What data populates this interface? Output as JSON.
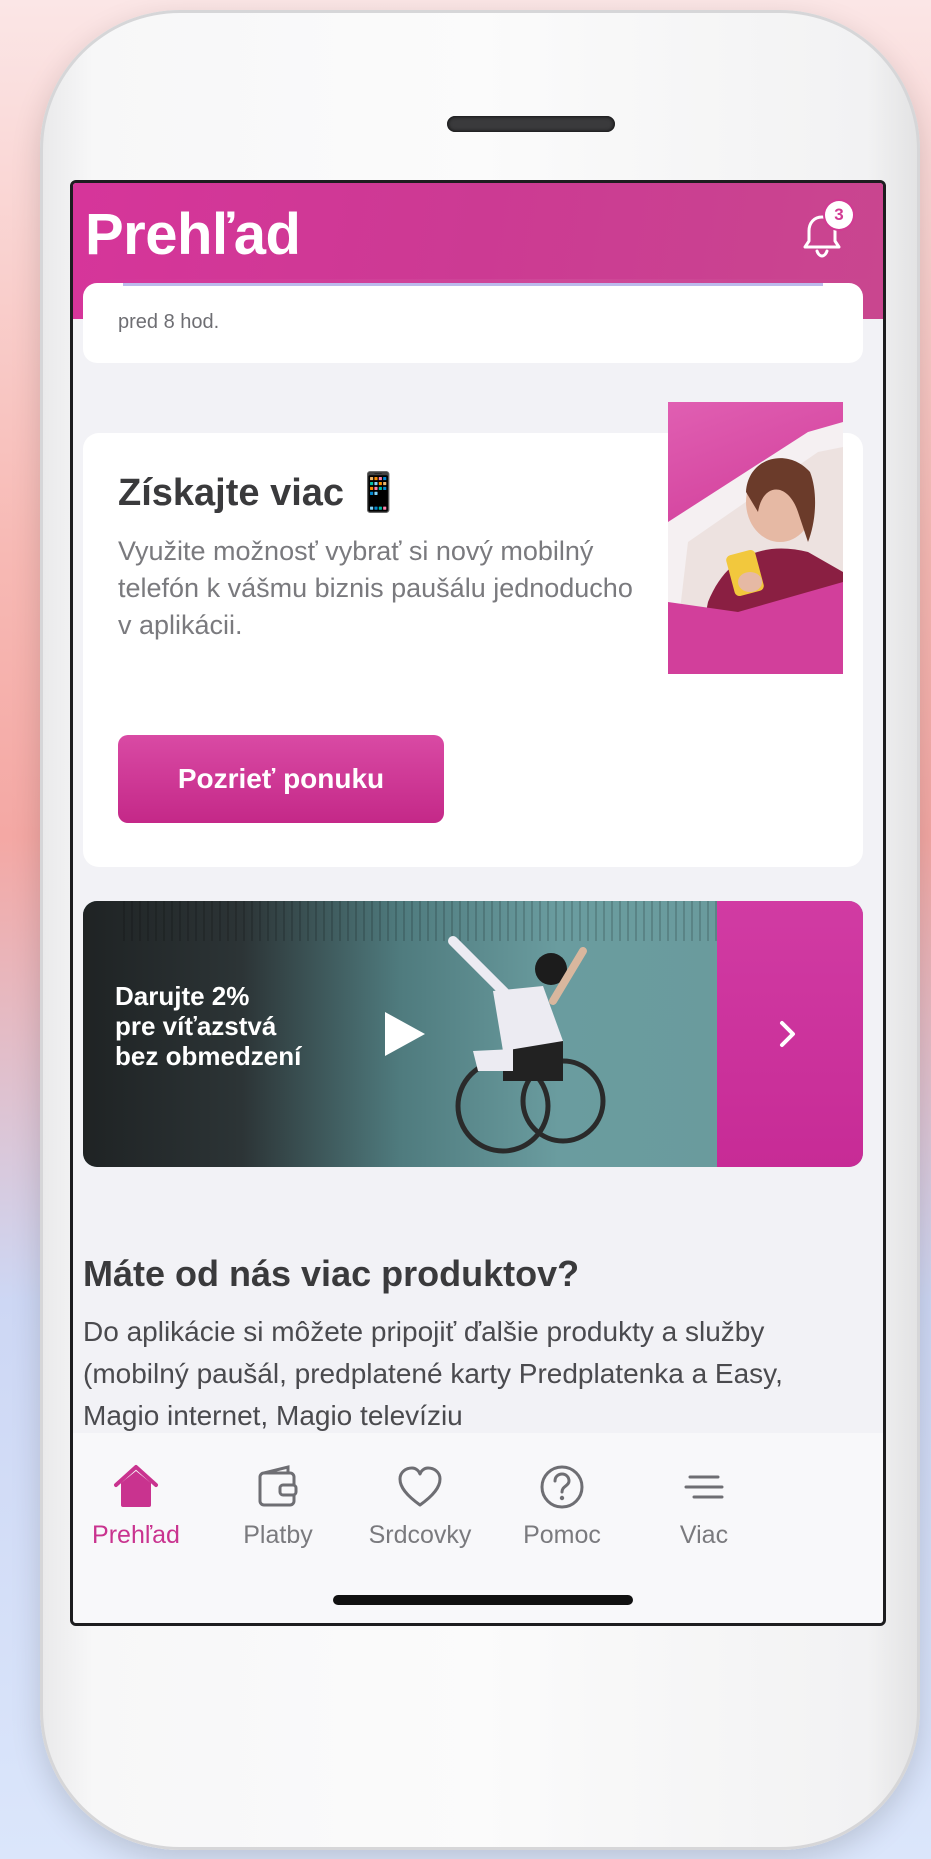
{
  "header": {
    "title": "Prehľad",
    "notification_count": "3"
  },
  "notification_card": {
    "time": "pred 8 hod."
  },
  "promo": {
    "title": "Získajte viac 📱",
    "description": "Využite možnosť vybrať si nový mobilný telefón k vášmu biznis paušálu jednoducho v aplikácii.",
    "button_label": "Pozrieť ponuku"
  },
  "banner": {
    "text": "Darujte 2%\npre víťazstvá\nbez obmedzení"
  },
  "products": {
    "title": "Máte od nás viac produktov?",
    "text": "Do aplikácie si môžete pripojiť ďalšie produkty a služby (mobilný paušál, predplatené karty Predplatenka a Easy, Magio internet, Magio televíziu"
  },
  "tabs": [
    {
      "label": "Prehľad",
      "icon": "home-icon",
      "active": true
    },
    {
      "label": "Platby",
      "icon": "wallet-icon",
      "active": false
    },
    {
      "label": "Srdcovky",
      "icon": "heart-icon",
      "active": false
    },
    {
      "label": "Pomoc",
      "icon": "help-icon",
      "active": false
    },
    {
      "label": "Viac",
      "icon": "menu-icon",
      "active": false
    }
  ],
  "colors": {
    "brand": "#d6359a",
    "active_tab": "#c9338f",
    "text_dark": "#3a3a3c",
    "text_muted": "#7a7a7e"
  }
}
